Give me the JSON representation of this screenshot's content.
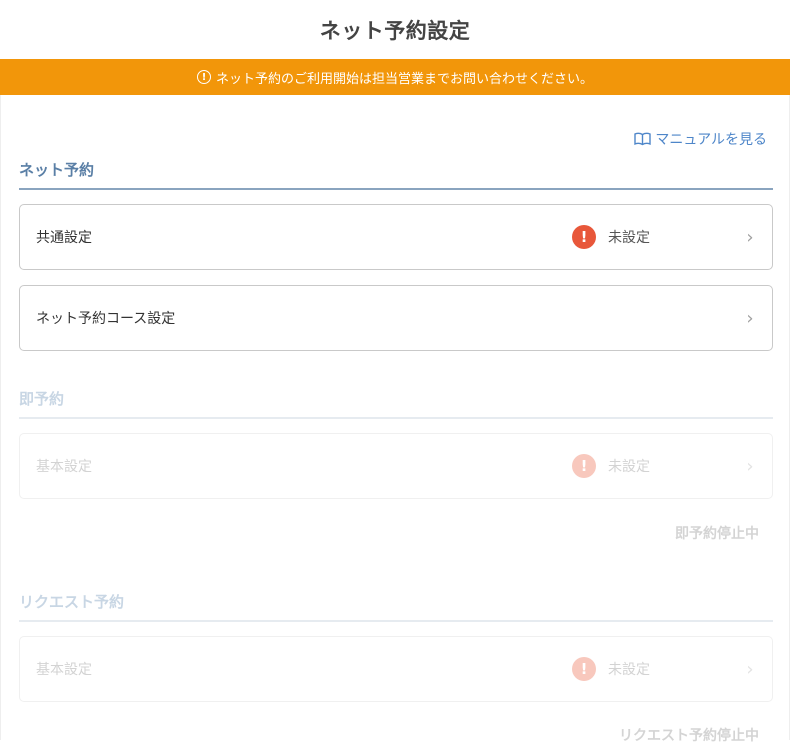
{
  "header": {
    "title": "ネット予約設定"
  },
  "banner": {
    "icon": "info-icon",
    "text": "ネット予約のご利用開始は担当営業までお問い合わせください。",
    "color": "#f2960a"
  },
  "manual": {
    "icon": "book-icon",
    "label": "マニュアルを見る"
  },
  "sections": {
    "net": {
      "title": "ネット予約",
      "items": [
        {
          "label": "共通設定",
          "status": "未設定",
          "status_icon": "warning-icon"
        },
        {
          "label": "ネット予約コース設定"
        }
      ]
    },
    "instant": {
      "title": "即予約",
      "items": [
        {
          "label": "基本設定",
          "status": "未設定",
          "status_icon": "warning-icon"
        }
      ],
      "stopped_note": "即予約停止中"
    },
    "request": {
      "title": "リクエスト予約",
      "items": [
        {
          "label": "基本設定",
          "status": "未設定",
          "status_icon": "warning-icon"
        }
      ],
      "stopped_note": "リクエスト予約停止中"
    }
  },
  "colors": {
    "accent": "#5a7fa6",
    "warning": "#e8573a",
    "link": "#4e86c9"
  }
}
